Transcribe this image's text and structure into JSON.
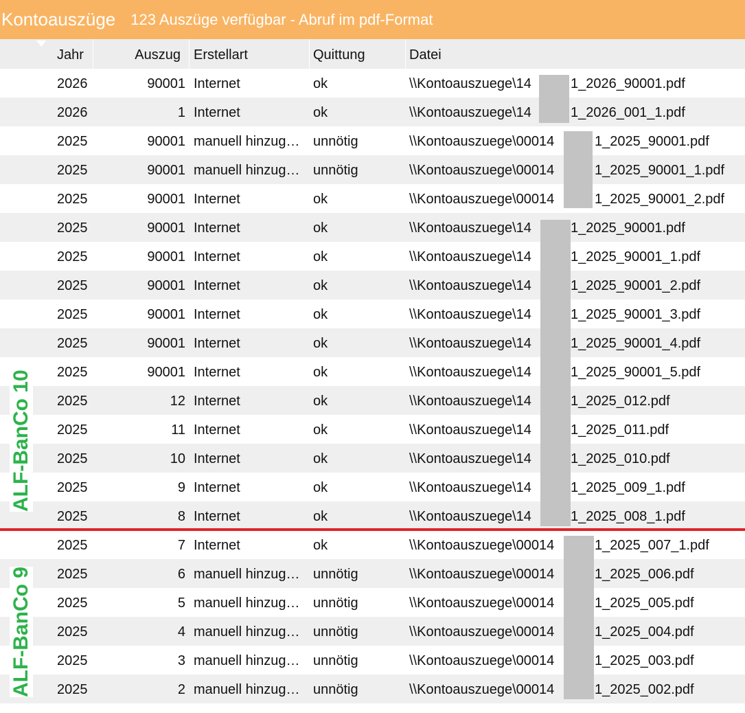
{
  "header": {
    "title": "Kontoauszüge",
    "subtitle": "123 Auszüge verfügbar - Abruf im pdf-Format"
  },
  "columns": [
    "Jahr",
    "Auszug",
    "Erstellart",
    "Quittung",
    "Datei"
  ],
  "rows": [
    {
      "jahr": "2026",
      "auszug": "90001",
      "erstellart": "Internet",
      "quittung": "ok",
      "file_prefix": "\\\\Kontoauszuege\\14",
      "file_suffix": "1_2026_90001.pdf"
    },
    {
      "jahr": "2026",
      "auszug": "1",
      "erstellart": "Internet",
      "quittung": "ok",
      "file_prefix": "\\\\Kontoauszuege\\14",
      "file_suffix": "1_2026_001_1.pdf"
    },
    {
      "jahr": "2025",
      "auszug": "90001",
      "erstellart": "manuell hinzugefügt",
      "quittung": "unnötig",
      "file_prefix": "\\\\Kontoauszuege\\00014",
      "file_suffix": "1_2025_90001.pdf"
    },
    {
      "jahr": "2025",
      "auszug": "90001",
      "erstellart": "manuell hinzugefügt",
      "quittung": "unnötig",
      "file_prefix": "\\\\Kontoauszuege\\00014",
      "file_suffix": "1_2025_90001_1.pdf"
    },
    {
      "jahr": "2025",
      "auszug": "90001",
      "erstellart": "Internet",
      "quittung": "ok",
      "file_prefix": "\\\\Kontoauszuege\\00014",
      "file_suffix": "1_2025_90001_2.pdf"
    },
    {
      "jahr": "2025",
      "auszug": "90001",
      "erstellart": "Internet",
      "quittung": "ok",
      "file_prefix": "\\\\Kontoauszuege\\14",
      "file_suffix": "1_2025_90001.pdf"
    },
    {
      "jahr": "2025",
      "auszug": "90001",
      "erstellart": "Internet",
      "quittung": "ok",
      "file_prefix": "\\\\Kontoauszuege\\14",
      "file_suffix": "1_2025_90001_1.pdf"
    },
    {
      "jahr": "2025",
      "auszug": "90001",
      "erstellart": "Internet",
      "quittung": "ok",
      "file_prefix": "\\\\Kontoauszuege\\14",
      "file_suffix": "1_2025_90001_2.pdf"
    },
    {
      "jahr": "2025",
      "auszug": "90001",
      "erstellart": "Internet",
      "quittung": "ok",
      "file_prefix": "\\\\Kontoauszuege\\14",
      "file_suffix": "1_2025_90001_3.pdf"
    },
    {
      "jahr": "2025",
      "auszug": "90001",
      "erstellart": "Internet",
      "quittung": "ok",
      "file_prefix": "\\\\Kontoauszuege\\14",
      "file_suffix": "1_2025_90001_4.pdf"
    },
    {
      "jahr": "2025",
      "auszug": "90001",
      "erstellart": "Internet",
      "quittung": "ok",
      "file_prefix": "\\\\Kontoauszuege\\14",
      "file_suffix": "1_2025_90001_5.pdf"
    },
    {
      "jahr": "2025",
      "auszug": "12",
      "erstellart": "Internet",
      "quittung": "ok",
      "file_prefix": "\\\\Kontoauszuege\\14",
      "file_suffix": "1_2025_012.pdf"
    },
    {
      "jahr": "2025",
      "auszug": "11",
      "erstellart": "Internet",
      "quittung": "ok",
      "file_prefix": "\\\\Kontoauszuege\\14",
      "file_suffix": "1_2025_011.pdf"
    },
    {
      "jahr": "2025",
      "auszug": "10",
      "erstellart": "Internet",
      "quittung": "ok",
      "file_prefix": "\\\\Kontoauszuege\\14",
      "file_suffix": "1_2025_010.pdf"
    },
    {
      "jahr": "2025",
      "auszug": "9",
      "erstellart": "Internet",
      "quittung": "ok",
      "file_prefix": "\\\\Kontoauszuege\\14",
      "file_suffix": "1_2025_009_1.pdf"
    },
    {
      "jahr": "2025",
      "auszug": "8",
      "erstellart": "Internet",
      "quittung": "ok",
      "file_prefix": "\\\\Kontoauszuege\\14",
      "file_suffix": "1_2025_008_1.pdf"
    },
    {
      "jahr": "2025",
      "auszug": "7",
      "erstellart": "Internet",
      "quittung": "ok",
      "file_prefix": "\\\\Kontoauszuege\\00014",
      "file_suffix": "1_2025_007_1.pdf"
    },
    {
      "jahr": "2025",
      "auszug": "6",
      "erstellart": "manuell hinzugefügt",
      "quittung": "unnötig",
      "file_prefix": "\\\\Kontoauszuege\\00014",
      "file_suffix": "1_2025_006.pdf"
    },
    {
      "jahr": "2025",
      "auszug": "5",
      "erstellart": "manuell hinzugefügt",
      "quittung": "unnötig",
      "file_prefix": "\\\\Kontoauszuege\\00014",
      "file_suffix": "1_2025_005.pdf"
    },
    {
      "jahr": "2025",
      "auszug": "4",
      "erstellart": "manuell hinzugefügt",
      "quittung": "unnötig",
      "file_prefix": "\\\\Kontoauszuege\\00014",
      "file_suffix": "1_2025_004.pdf"
    },
    {
      "jahr": "2025",
      "auszug": "3",
      "erstellart": "manuell hinzugefügt",
      "quittung": "unnötig",
      "file_prefix": "\\\\Kontoauszuege\\00014",
      "file_suffix": "1_2025_003.pdf"
    },
    {
      "jahr": "2025",
      "auszug": "2",
      "erstellart": "manuell hinzugefügt",
      "quittung": "unnötig",
      "file_prefix": "\\\\Kontoauszuege\\00014",
      "file_suffix": "1_2025_002.pdf"
    }
  ],
  "annotations": {
    "version_10_label": "ALF-BanCo 10",
    "version_9_label": "ALF-BanCo 9"
  },
  "colors": {
    "titlebar": "#F9B463",
    "label_green": "#2DB34A",
    "divider_red": "#E0232A",
    "redaction": "#C3C3C3"
  }
}
